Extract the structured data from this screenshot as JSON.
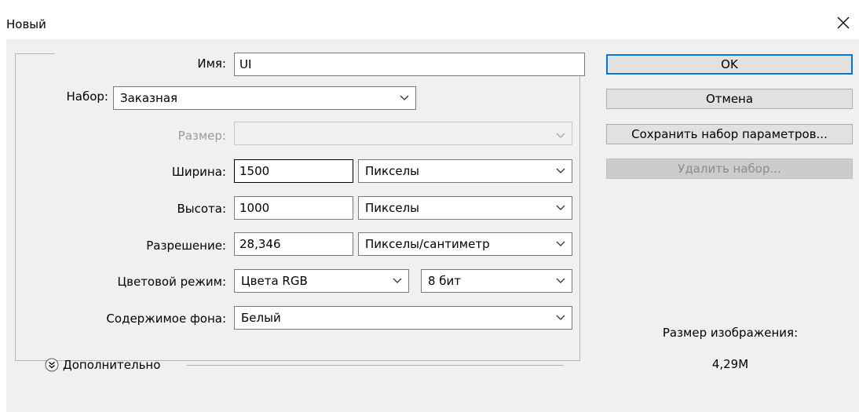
{
  "window": {
    "title": "Новый"
  },
  "form": {
    "name": {
      "label": "Имя:",
      "value": "UI"
    },
    "preset": {
      "label": "Набор:",
      "value": "Заказная"
    },
    "size": {
      "label": "Размер:",
      "value": ""
    },
    "width": {
      "label": "Ширина:",
      "value": "1500",
      "unit": "Пикселы"
    },
    "height": {
      "label": "Высота:",
      "value": "1000",
      "unit": "Пикселы"
    },
    "resolution": {
      "label": "Разрешение:",
      "value": "28,346",
      "unit": "Пикселы/сантиметр"
    },
    "color_mode": {
      "label": "Цветовой режим:",
      "value": "Цвета RGB",
      "depth": "8 бит"
    },
    "background": {
      "label": "Содержимое фона:",
      "value": "Белый"
    },
    "advanced": {
      "label": "Дополнительно"
    }
  },
  "buttons": {
    "ok": "OK",
    "cancel": "Отмена",
    "save_preset": "Сохранить набор параметров...",
    "delete_preset": "Удалить набор..."
  },
  "info": {
    "image_size_label": "Размер изображения:",
    "image_size_value": "4,29M"
  },
  "colors": {
    "accent": "#0078d7",
    "dialog_bg": "#f0f0f0"
  }
}
